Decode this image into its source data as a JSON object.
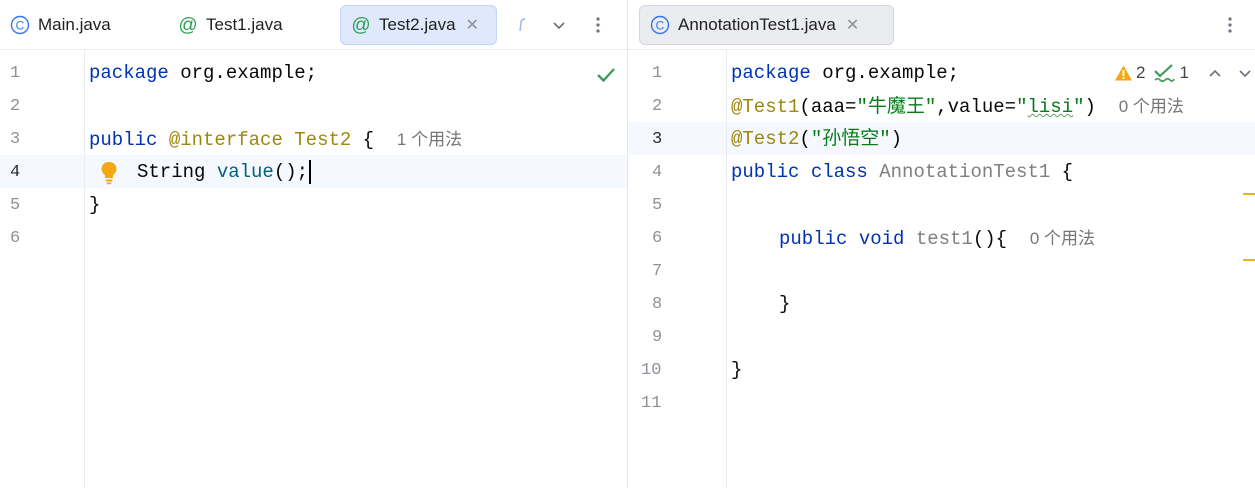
{
  "left": {
    "tabs": [
      {
        "label": "Main.java",
        "icon": "class-icon"
      },
      {
        "label": "Test1.java",
        "icon": "annotation-icon"
      },
      {
        "label": "Test2.java",
        "icon": "annotation-icon",
        "active": true
      }
    ],
    "line_numbers": [
      "1",
      "2",
      "3",
      "4",
      "5",
      "6"
    ],
    "code": {
      "l1_kw": "package",
      "l1_rest": " org.example;",
      "l3_kw": "public",
      "l3_ann": "@interface",
      "l3_name": "Test2",
      "l3_brace": " {",
      "l3_hint": "1 个用法",
      "l4_type": "String ",
      "l4_fn": "value",
      "l4_rest": "();",
      "l5": "}"
    }
  },
  "right": {
    "tabs": [
      {
        "label": "AnnotationTest1.java",
        "icon": "class-icon",
        "active": true
      }
    ],
    "inspections": {
      "warnings": "2",
      "weak_warnings": "1"
    },
    "line_numbers": [
      "1",
      "2",
      "3",
      "4",
      "5",
      "6",
      "7",
      "8",
      "9",
      "10",
      "11"
    ],
    "code": {
      "l1_kw": "package",
      "l1_rest": " org.example;",
      "l2_ann": "@Test1",
      "l2_a": "(aaa=",
      "l2_s1": "\"牛魔王\"",
      "l2_b": ",value=",
      "l2_s2_q1": "\"",
      "l2_s2_word": "lisi",
      "l2_s2_q2": "\"",
      "l2_c": ")",
      "l2_hint": "0 个用法",
      "l3_ann": "@Test2",
      "l3_a": "(",
      "l3_s": "\"孙悟空\"",
      "l3_b": ")",
      "l4_kw": "public class ",
      "l4_name": "AnnotationTest1",
      "l4_brace": " {",
      "l6_kw": "public void ",
      "l6_fn": "test1",
      "l6_rest": "(){",
      "l6_hint": "0 个用法",
      "l8": "}",
      "l10": "}"
    }
  },
  "colors": {
    "keyword": "#0033b3",
    "annotation": "#9e880d",
    "string": "#067d17",
    "function": "#00627a",
    "active_tab": "#dfe9fb"
  }
}
